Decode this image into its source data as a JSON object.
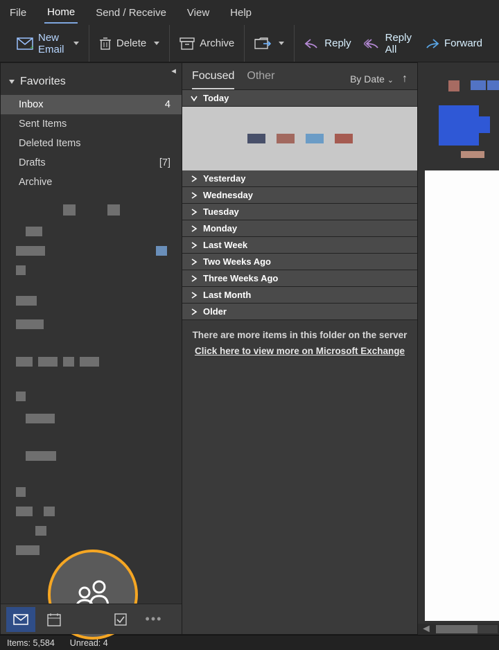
{
  "menu": {
    "file": "File",
    "home": "Home",
    "sendreceive": "Send / Receive",
    "view": "View",
    "help": "Help"
  },
  "toolbar": {
    "newemail": "New Email",
    "delete": "Delete",
    "archive": "Archive",
    "reply": "Reply",
    "replyall": "Reply All",
    "forward": "Forward"
  },
  "nav": {
    "favorites": "Favorites",
    "folders": [
      {
        "name": "Inbox",
        "count": "4",
        "selected": true
      },
      {
        "name": "Sent Items",
        "count": "",
        "selected": false
      },
      {
        "name": "Deleted Items",
        "count": "",
        "selected": false
      },
      {
        "name": "Drafts",
        "count": "[7]",
        "selected": false
      },
      {
        "name": "Archive",
        "count": "",
        "selected": false
      }
    ]
  },
  "list": {
    "tab_focused": "Focused",
    "tab_other": "Other",
    "sort_label": "By Date",
    "groups": [
      "Today",
      "Yesterday",
      "Wednesday",
      "Tuesday",
      "Monday",
      "Last Week",
      "Two Weeks Ago",
      "Three Weeks Ago",
      "Last Month",
      "Older"
    ],
    "more_items": "There are more items in this folder on the server",
    "more_link": "Click here to view more on Microsoft Exchange",
    "today_swatches": [
      "#48506a",
      "#a2695f",
      "#6b9cc6",
      "#a55b51"
    ]
  },
  "switch": {
    "more": "•••"
  },
  "status": {
    "items": "Items: 5,584",
    "unread": "Unread: 4"
  },
  "highlight": {
    "target": "people-icon"
  }
}
